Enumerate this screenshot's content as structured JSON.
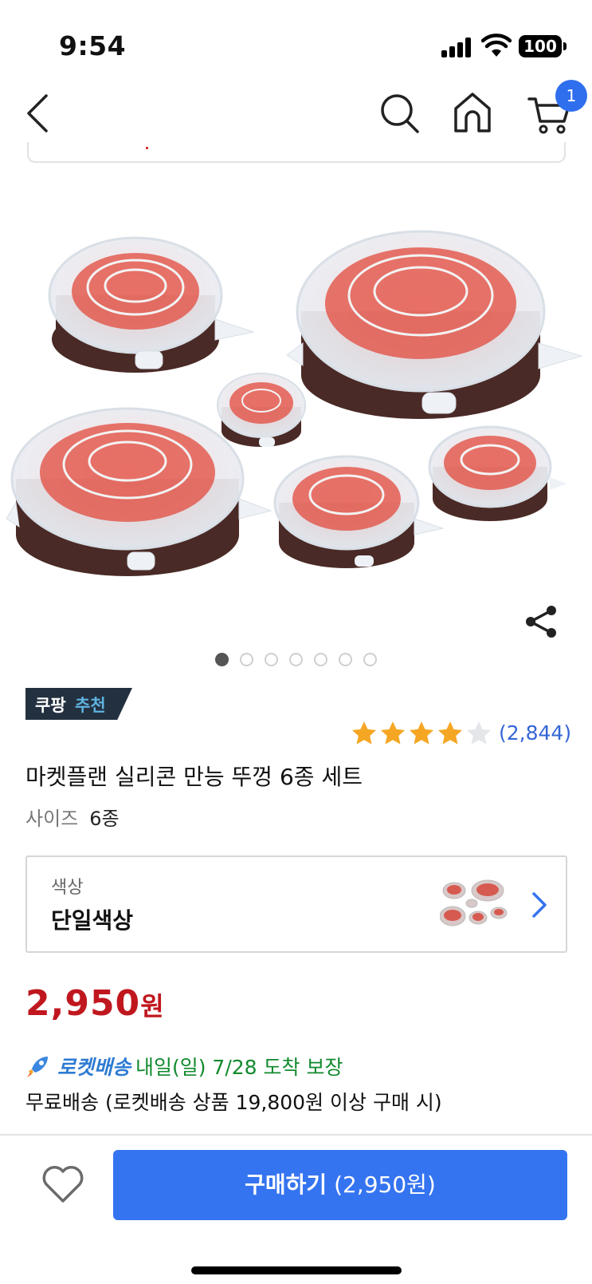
{
  "status": {
    "time": "9:54",
    "battery": "100"
  },
  "nav": {
    "cart_count": "1"
  },
  "product": {
    "badge_left": "쿠팡",
    "badge_right": "추천",
    "rating": 4,
    "rating_max": 5,
    "review_count": "(2,844)",
    "title": "마켓플랜 실리콘 만능 뚜껑 6종 세트",
    "size_label": "사이즈",
    "size_value": "6종",
    "image_page": 1,
    "image_pages": 7
  },
  "option": {
    "label": "색상",
    "value": "단일색상"
  },
  "price": {
    "amount": "2,950",
    "unit": "원"
  },
  "delivery": {
    "service": "로켓배송",
    "arrival": "내일(일) 7/28 도착 보장",
    "free_shipping": "무료배송 (로켓배송 상품 19,800원 이상 구매 시)"
  },
  "buy": {
    "label": "구매하기",
    "price": "(2,950원)"
  },
  "colors": {
    "accent": "#3574f0",
    "price": "#c0171f",
    "star": "#f5a623",
    "review": "#3566d6",
    "arrival": "#128a2e"
  },
  "icons": [
    "chevron-left-icon",
    "search-icon",
    "home-icon",
    "cart-icon",
    "share-icon",
    "star-icon",
    "chevron-right-icon",
    "rocket-icon",
    "heart-icon"
  ]
}
